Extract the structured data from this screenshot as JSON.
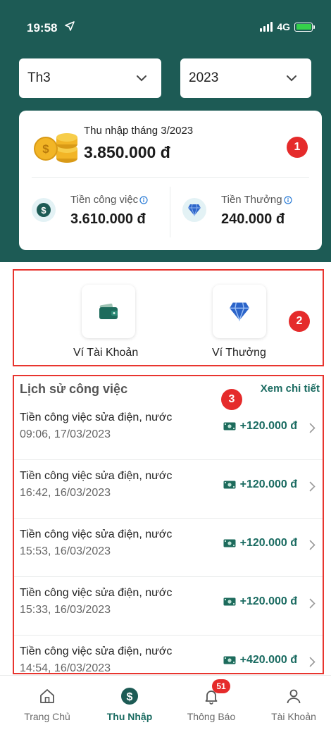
{
  "status_bar": {
    "time": "19:58",
    "network": "4G"
  },
  "filters": {
    "month": "Th3",
    "year": "2023"
  },
  "summary": {
    "label": "Thu nhập tháng 3/2023",
    "amount": "3.850.000 đ",
    "badge": "1",
    "work": {
      "label": "Tiền công việc",
      "value": "3.610.000 đ"
    },
    "bonus": {
      "label": "Tiền Thưởng",
      "value": "240.000 đ"
    }
  },
  "wallets": {
    "badge": "2",
    "items": [
      {
        "label": "Ví Tài Khoản",
        "icon": "wallet-icon"
      },
      {
        "label": "Ví Thưởng",
        "icon": "diamond-icon"
      }
    ]
  },
  "history": {
    "title": "Lịch sử công việc",
    "more": "Xem chi tiết",
    "badge": "3",
    "items": [
      {
        "title": "Tiền công việc sửa điện, nước",
        "time": "09:06, 17/03/2023",
        "amount": "+120.000 đ"
      },
      {
        "title": "Tiền công việc sửa điện, nước",
        "time": "16:42, 16/03/2023",
        "amount": "+120.000 đ"
      },
      {
        "title": "Tiền công việc sửa điện, nước",
        "time": "15:53, 16/03/2023",
        "amount": "+120.000 đ"
      },
      {
        "title": "Tiền công việc sửa điện, nước",
        "time": "15:33, 16/03/2023",
        "amount": "+120.000 đ"
      },
      {
        "title": "Tiền công việc sửa điện, nước",
        "time": "14:54, 16/03/2023",
        "amount": "+420.000 đ"
      }
    ]
  },
  "nav": {
    "items": [
      {
        "label": "Trang Chủ",
        "icon": "home-icon"
      },
      {
        "label": "Thu Nhập",
        "icon": "dollar-icon"
      },
      {
        "label": "Thông Báo",
        "icon": "bell-icon",
        "count": "51"
      },
      {
        "label": "Tài Khoản",
        "icon": "user-icon"
      }
    ]
  },
  "colors": {
    "primary": "#1d5b55",
    "accent": "#1a6b61",
    "highlight": "#e8352f"
  }
}
